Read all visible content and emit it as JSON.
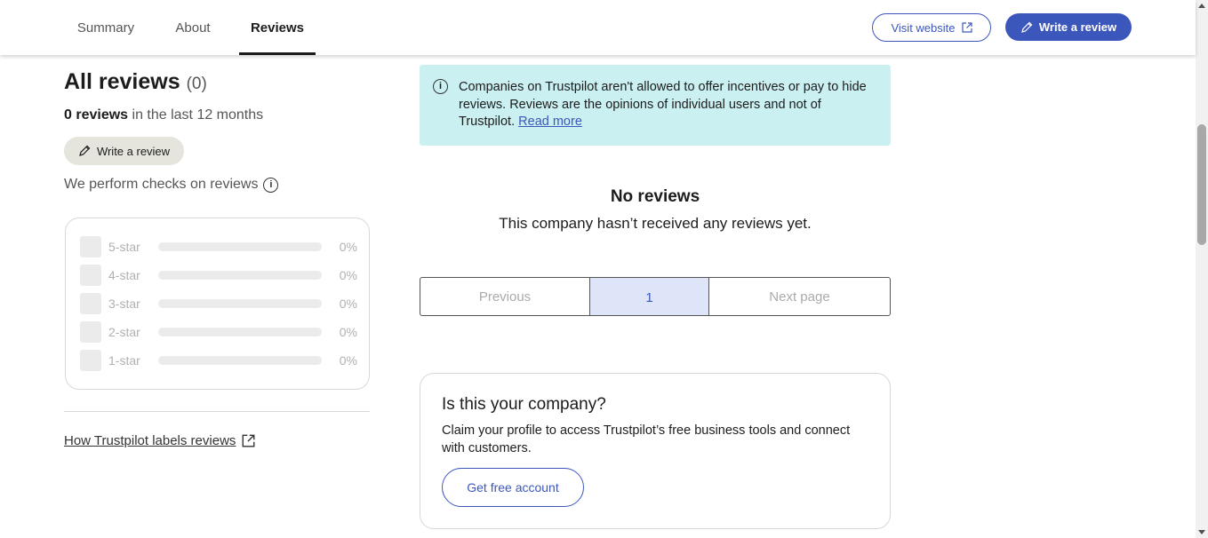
{
  "nav": {
    "tabs": [
      {
        "label": "Summary"
      },
      {
        "label": "About"
      },
      {
        "label": "Reviews"
      }
    ],
    "visit_website": "Visit website",
    "write_review": "Write a review"
  },
  "left": {
    "heading": "All reviews",
    "heading_count": "(0)",
    "reviews_count": "0 reviews",
    "reviews_period": " in the last 12 months",
    "write_review": "Write a review",
    "checks_text": "We perform checks on reviews",
    "distribution": [
      {
        "label": "5-star",
        "percent": "0%"
      },
      {
        "label": "4-star",
        "percent": "0%"
      },
      {
        "label": "3-star",
        "percent": "0%"
      },
      {
        "label": "2-star",
        "percent": "0%"
      },
      {
        "label": "1-star",
        "percent": "0%"
      }
    ],
    "labels_link": "How Trustpilot labels reviews"
  },
  "notice": {
    "text": "Companies on Trustpilot aren't allowed to offer incentives or pay to hide reviews. Reviews are the opinions of individual users and not of Trustpilot. ",
    "link": "Read more"
  },
  "empty": {
    "title": "No reviews",
    "subtitle": "This company hasn’t received any reviews yet."
  },
  "pagination": {
    "previous": "Previous",
    "current": "1",
    "next": "Next page"
  },
  "claim": {
    "title": "Is this your company?",
    "body": "Claim your profile to access Trustpilot’s free business tools and connect with customers.",
    "button": "Get free account"
  },
  "colors": {
    "accent": "#3c57bc",
    "notice_bg": "#cbf0f2",
    "current_page_bg": "#dfe5f9"
  }
}
